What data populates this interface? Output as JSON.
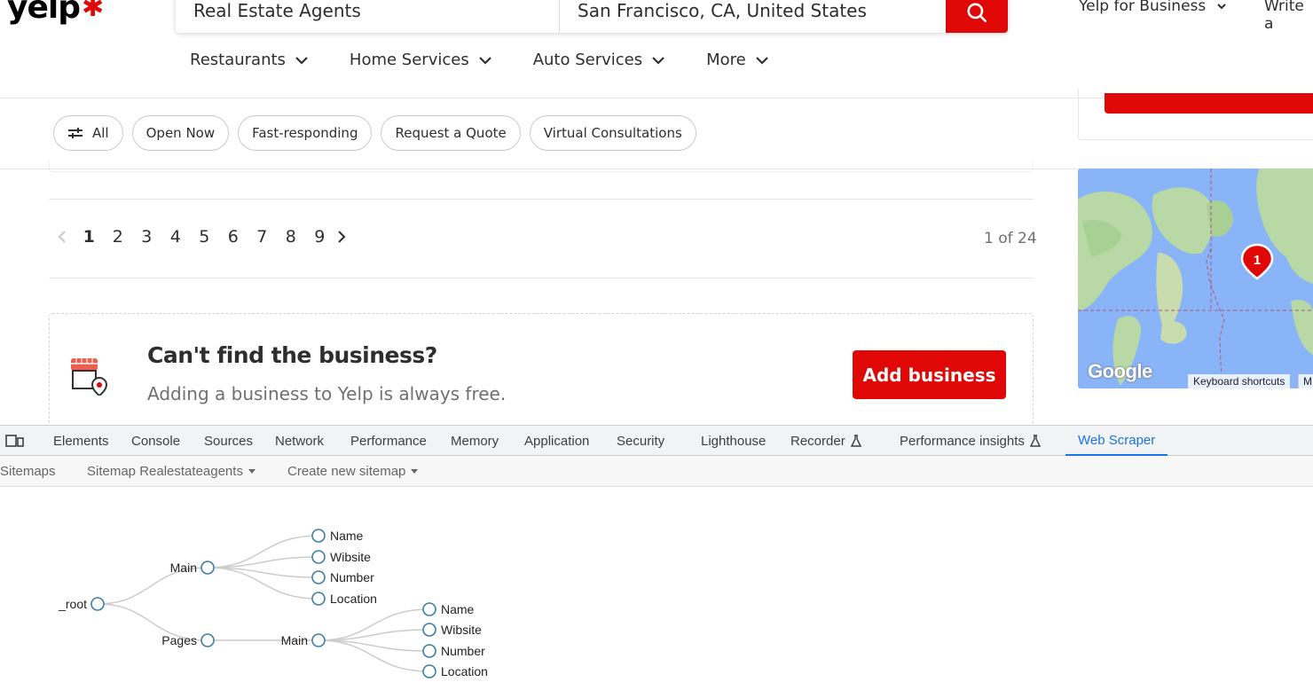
{
  "header": {
    "logo": "yelp",
    "search_what": "Real Estate Agents",
    "search_where": "San Francisco, CA, United States",
    "yelp_for_business": "Yelp for Business",
    "write_review": "Write a",
    "nav": [
      "Restaurants",
      "Home Services",
      "Auto Services",
      "More"
    ]
  },
  "filters": [
    "All",
    "Open Now",
    "Fast-responding",
    "Request a Quote",
    "Virtual Consultations"
  ],
  "pagination": {
    "pages": [
      "1",
      "2",
      "3",
      "4",
      "5",
      "6",
      "7",
      "8",
      "9"
    ],
    "current": "1",
    "count_text": "1 of 24"
  },
  "cta": {
    "title": "Can't find the business?",
    "subtitle": "Adding a business to Yelp is always free.",
    "button": "Add business"
  },
  "map": {
    "logo": "Google",
    "shortcuts": "Keyboard shortcuts",
    "attr2": "M",
    "marker_count": "1"
  },
  "devtools": {
    "tabs": [
      "Elements",
      "Console",
      "Sources",
      "Network",
      "Performance",
      "Memory",
      "Application",
      "Security",
      "Lighthouse",
      "Recorder",
      "Performance insights",
      "Web Scraper"
    ],
    "active_tab": "Web Scraper"
  },
  "webscraper": {
    "menu": [
      "Sitemaps",
      "Sitemap Realestateagents",
      "Create new sitemap"
    ],
    "tree": {
      "root": "_root",
      "main": "Main",
      "pages": "Pages",
      "pages_main": "Main",
      "main_children": [
        "Name",
        "Wibsite",
        "Number",
        "Location"
      ],
      "pages_main_children": [
        "Name",
        "Wibsite",
        "Number",
        "Location"
      ]
    }
  },
  "colors": {
    "brand_red": "#e00707",
    "devtools_active": "#1a73e8",
    "tree_node": "#3d7ea6"
  }
}
